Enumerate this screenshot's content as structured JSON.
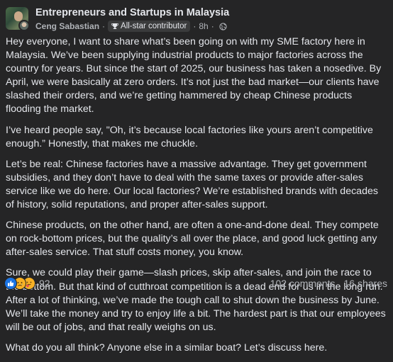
{
  "post": {
    "group_name": "Entrepreneurs and Startups in Malaysia",
    "author": "Ceng Sabastian",
    "author_badge": "All-star contributor",
    "time": "8h",
    "paragraphs": [
      "Hey everyone, I want to share what’s been going on with my SME factory here in Malaysia. We’ve been supplying industrial products to major factories across the country for years. But since the start of 2025, our business has taken a nosedive. By April, we were basically at zero orders. It’s not just the bad market—our clients have slashed their orders, and we’re getting hammered by cheap Chinese products flooding the market.",
      "I’ve heard people say, \"Oh, it’s because local factories like yours aren’t competitive enough.” Honestly, that makes me chuckle.",
      "Let’s be real: Chinese factories have a massive advantage. They get government subsidies, and they don’t have to deal with the same taxes or provide after-sales service like we do here. Our local factories? We’re established brands with decades of history, solid reputations, and proper after-sales support.",
      "Chinese products, on the other hand, are often a one-and-done deal. They compete on rock-bottom prices, but the quality’s all over the place, and good luck getting any after-sales service. That stuff costs money, you know.",
      "Sure, we could play their game—slash prices, skip after-sales, and join the race to the bottom. But that kind of cutthroat competition is a dead end for us in the long run. After a lot of thinking, we’ve made the tough call to shut down the business by June. We’ll take the money and try to enjoy life a bit. The hardest part is that our employees will be out of jobs, and that really weighs on us.",
      "What do you all think? Anyone else in a similar boat? Let’s discuss here."
    ]
  },
  "footer": {
    "reaction_icons": [
      "like-icon",
      "sad-icon",
      "care-icon"
    ],
    "reaction_count": "92",
    "comments": "102 comments",
    "shares": "16 shares"
  },
  "colors": {
    "background": "#252526",
    "text": "#e4e6eb",
    "secondary": "#b0b3b8",
    "like": "#1b74e4",
    "emoji": "#f7b125"
  }
}
